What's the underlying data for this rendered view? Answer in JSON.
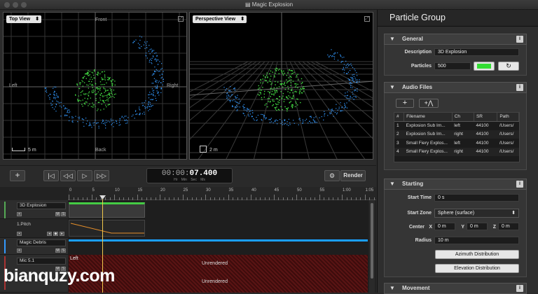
{
  "window": {
    "title": "Magic Explosion"
  },
  "top_view": {
    "selector": "Top View",
    "front": "Front",
    "back": "Back",
    "left": "Left",
    "right": "Right",
    "scale": "5 m"
  },
  "persp_view": {
    "selector": "Perspective View",
    "scale": "2 m"
  },
  "transport": {
    "add": "+",
    "timecode_dim": "00:00:",
    "timecode_main": "07.400",
    "timecode_units": "Hr Min Sec Ms",
    "render": "Render"
  },
  "ruler": {
    "labels": [
      "0",
      "5",
      "10",
      "15",
      "20",
      "25",
      "30",
      "35",
      "40",
      "45",
      "50",
      "55",
      "1:00",
      "1:05"
    ]
  },
  "tracks": [
    {
      "name": "3D Explosion"
    },
    {
      "name": "1.Pitch"
    },
    {
      "name": "Magic Debris"
    },
    {
      "name": "Mic 5.1"
    }
  ],
  "timeline": {
    "channel_left": "Left",
    "unrendered": [
      "Unrendered",
      "Unrendered"
    ]
  },
  "inspector": {
    "title": "Particle Group",
    "general": {
      "header": "General",
      "description_label": "Description",
      "description_value": "3D Explosion",
      "particles_label": "Particles",
      "particles_value": "500",
      "color": "#33dd33"
    },
    "audio": {
      "header": "Audio Files",
      "columns": [
        "#",
        "Filename",
        "Ch",
        "SR",
        "Path"
      ],
      "rows": [
        [
          "1",
          "Explosion Sub Im...",
          "left",
          "44100",
          "/Users/"
        ],
        [
          "2",
          "Explosion Sub Im...",
          "right",
          "44100",
          "/Users/"
        ],
        [
          "3",
          "Small Fiery Explos...",
          "left",
          "44100",
          "/Users/"
        ],
        [
          "4",
          "Small Fiery Explos...",
          "right",
          "44100",
          "/Users/"
        ]
      ]
    },
    "starting": {
      "header": "Starting",
      "start_time_label": "Start Time",
      "start_time_value": "0 s",
      "start_zone_label": "Start Zone",
      "start_zone_value": "Sphere (surface)",
      "center_label": "Center",
      "x_label": "X",
      "x_value": "0 m",
      "y_label": "Y",
      "y_value": "0 m",
      "z_label": "Z",
      "z_value": "0 m",
      "radius_label": "Radius",
      "radius_value": "10 m",
      "azimuth_btn": "Azimuth Distribution",
      "elevation_btn": "Elevation Distribution"
    },
    "movement": {
      "header": "Movement"
    }
  },
  "watermark": "bianquzy.com",
  "colors": {
    "green": "#44dd44",
    "blue": "#3399ff",
    "accent": "#00a0ff"
  }
}
